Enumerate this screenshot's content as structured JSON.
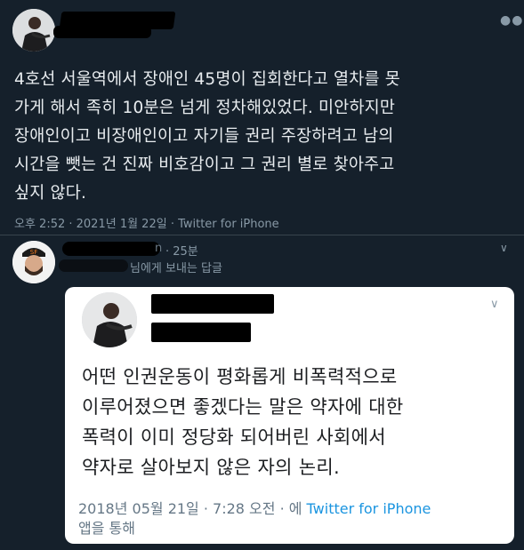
{
  "tweet": {
    "more_icon": "more-horizontal-icon",
    "text": "4호선 서울역에서 장애인 45명이 집회한다고 열차를 못가게 해서 족히 10분은 넘게 정차해있었다. 미안하지만 장애인이고 비장애인이고 자기들 권리 주장하려고 남의 시간을 뺏는 건 진짜 비호감이고 그 권리 별로 찾아주고 싶지 않다.",
    "lines": [
      "4호선 서울역에서 장애인 45명이 집회한다고 열차를 못",
      "가게 해서 족히 10분은 넘게 정차해있었다. 미안하지만",
      "장애인이고 비장애인이고 자기들 권리 주장하려고 남의",
      "시간을 뺏는 건 진짜 비호감이고 그 권리 별로 찾아주고",
      "싶지 않다."
    ],
    "meta": "오후 2:52 · 2021년 1월 22일 · Twitter for iPhone"
  },
  "reply": {
    "handle_fragment": "n",
    "time": "· 25분",
    "replying_to": "님에게 보내는 답글",
    "more_icon": "chevron-down-icon",
    "embed": {
      "lines": [
        "어떤 인권운동이 평화롭게 비폭력적으로",
        "이루어졌으면 좋겠다는 말은 약자에 대한",
        "폭력이 이미 정당화 되어버린 사회에서",
        "약자로 살아보지 않은 자의 논리."
      ],
      "meta_prefix": "2018년 05월 21일 · 7:28 오전 · 에 ",
      "meta_link": "Twitter for iPhone",
      "meta_suffix": "앱을 통해"
    }
  },
  "colors": {
    "background": "#15202b",
    "muted": "#8899a6",
    "link": "#1b95e0",
    "card": "#ffffff"
  }
}
